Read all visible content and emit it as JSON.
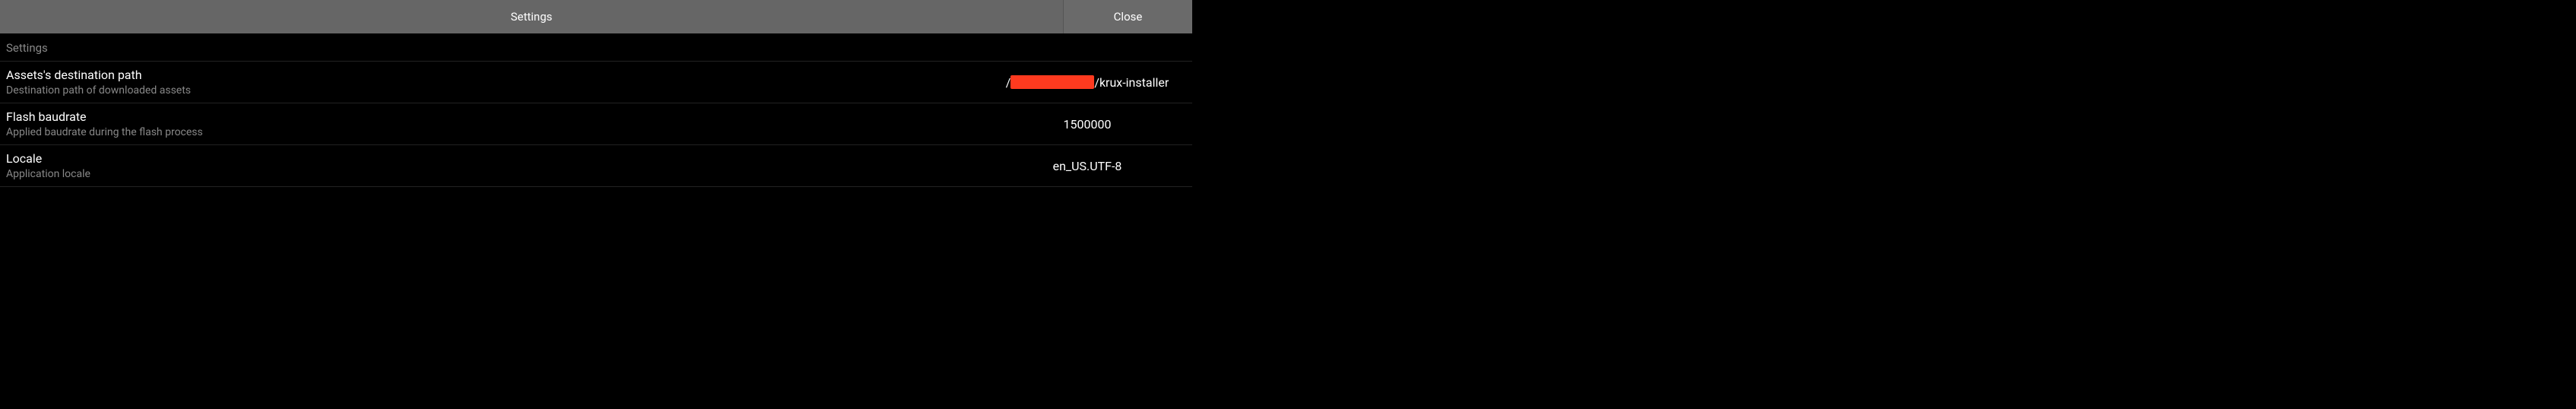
{
  "header": {
    "title": "Settings",
    "close_label": "Close"
  },
  "section": {
    "label": "Settings"
  },
  "settings": [
    {
      "title": "Assets's destination path",
      "description": "Destination path of downloaded assets",
      "value_prefix": "/",
      "value_suffix": "/krux-installer",
      "has_redacted": true
    },
    {
      "title": "Flash baudrate",
      "description": "Applied baudrate during the flash process",
      "value": "1500000",
      "has_redacted": false
    },
    {
      "title": "Locale",
      "description": "Application locale",
      "value": "en_US.UTF-8",
      "has_redacted": false
    }
  ]
}
